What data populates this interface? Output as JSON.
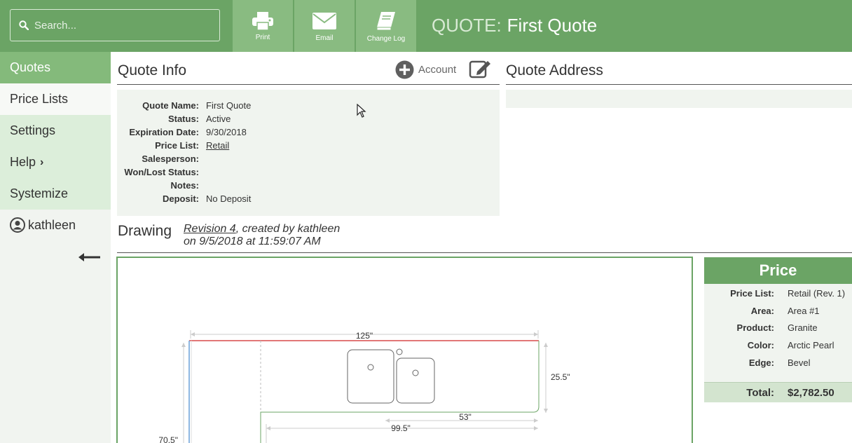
{
  "search": {
    "placeholder": "Search..."
  },
  "toolbar": {
    "print_label": "Print",
    "email_label": "Email",
    "changelog_label": "Change Log"
  },
  "header": {
    "prefix": "QUOTE:",
    "title": "First Quote"
  },
  "sidebar": {
    "items": [
      {
        "label": "Quotes"
      },
      {
        "label": "Price Lists"
      },
      {
        "label": "Settings"
      },
      {
        "label": "Help"
      },
      {
        "label": "Systemize"
      }
    ],
    "user": "kathleen"
  },
  "quote_info": {
    "title": "Quote Info",
    "account_label": "Account",
    "fields": [
      {
        "label": "Quote Name:",
        "value": "First Quote"
      },
      {
        "label": "Status:",
        "value": "Active"
      },
      {
        "label": "Expiration Date:",
        "value": "9/30/2018"
      },
      {
        "label": "Price List:",
        "value": "Retail"
      },
      {
        "label": "Salesperson:",
        "value": ""
      },
      {
        "label": "Won/Lost Status:",
        "value": ""
      },
      {
        "label": "Notes:",
        "value": ""
      },
      {
        "label": "Deposit:",
        "value": "No Deposit"
      }
    ]
  },
  "quote_address": {
    "title": "Quote Address"
  },
  "drawing": {
    "title": "Drawing",
    "revision_link": "Revision 4",
    "created_by": ", created by kathleen",
    "created_on": "on 9/5/2018 at 11:59:07 AM",
    "dimensions": {
      "top_width": "125\"",
      "right_depth": "25.5\"",
      "inner_width": "53\"",
      "bottom_width": "99.5\"",
      "left_height": "70.5\""
    }
  },
  "price": {
    "title": "Price",
    "rows": [
      {
        "label": "Price List:",
        "value": "Retail (Rev. 1)"
      },
      {
        "label": "Area:",
        "value": "Area #1"
      },
      {
        "label": "Product:",
        "value": "Granite"
      },
      {
        "label": "Color:",
        "value": "Arctic Pearl"
      },
      {
        "label": "Edge:",
        "value": "Bevel"
      }
    ],
    "total_label": "Total:",
    "total_value": "$2,782.50"
  },
  "colors": {
    "brand": "#6ba465",
    "brand_light": "#89bb81",
    "panel": "#f0f4ef"
  }
}
